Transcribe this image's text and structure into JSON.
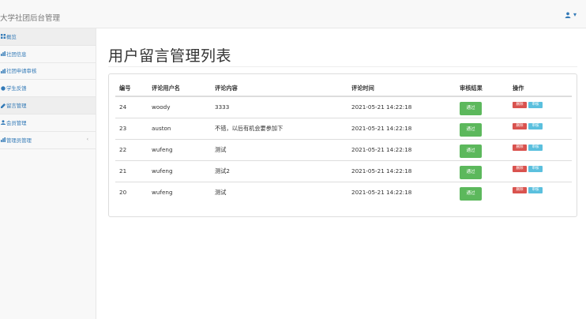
{
  "navbar": {
    "brand": "大学社团后台管理",
    "user_caret": "▾"
  },
  "sidebar": {
    "items": [
      {
        "label": "概览",
        "icon": "dashboard-icon",
        "active": true
      },
      {
        "label": "社团信息",
        "icon": "bar-chart-icon",
        "active": false
      },
      {
        "label": "社团申请审核",
        "icon": "bar-chart-icon",
        "active": false
      },
      {
        "label": "学生反馈",
        "icon": "circle-icon",
        "active": false
      },
      {
        "label": "留言管理",
        "icon": "edit-icon",
        "active": true
      },
      {
        "label": "会员管理",
        "icon": "user-icon",
        "active": false
      },
      {
        "label": "管理员管理",
        "icon": "bar-chart-icon",
        "active": false,
        "arrow": "‹"
      }
    ]
  },
  "main": {
    "title": "用户留言管理列表",
    "table": {
      "headers": [
        "编号",
        "评论用户名",
        "评论内容",
        "评论时间",
        "审核结果",
        "操作"
      ],
      "rows": [
        {
          "id": "24",
          "user": "woody",
          "content": "3333",
          "time": "2021-05-21 14:22:18",
          "result": "通过"
        },
        {
          "id": "23",
          "user": "auston",
          "content": "不错，以后有机会要参加下",
          "time": "2021-05-21 14:22:18",
          "result": "通过"
        },
        {
          "id": "22",
          "user": "wufeng",
          "content": "测试",
          "time": "2021-05-21 14:22:18",
          "result": "通过"
        },
        {
          "id": "21",
          "user": "wufeng",
          "content": "测试2",
          "time": "2021-05-21 14:22:18",
          "result": "通过"
        },
        {
          "id": "20",
          "user": "wufeng",
          "content": "测试",
          "time": "2021-05-21 14:22:18",
          "result": "通过"
        }
      ],
      "delete_label": "删除",
      "audit_label": "审核"
    }
  },
  "colors": {
    "link": "#337ab7",
    "success": "#5cb85c",
    "danger": "#d9534f",
    "info": "#5bc0de"
  }
}
